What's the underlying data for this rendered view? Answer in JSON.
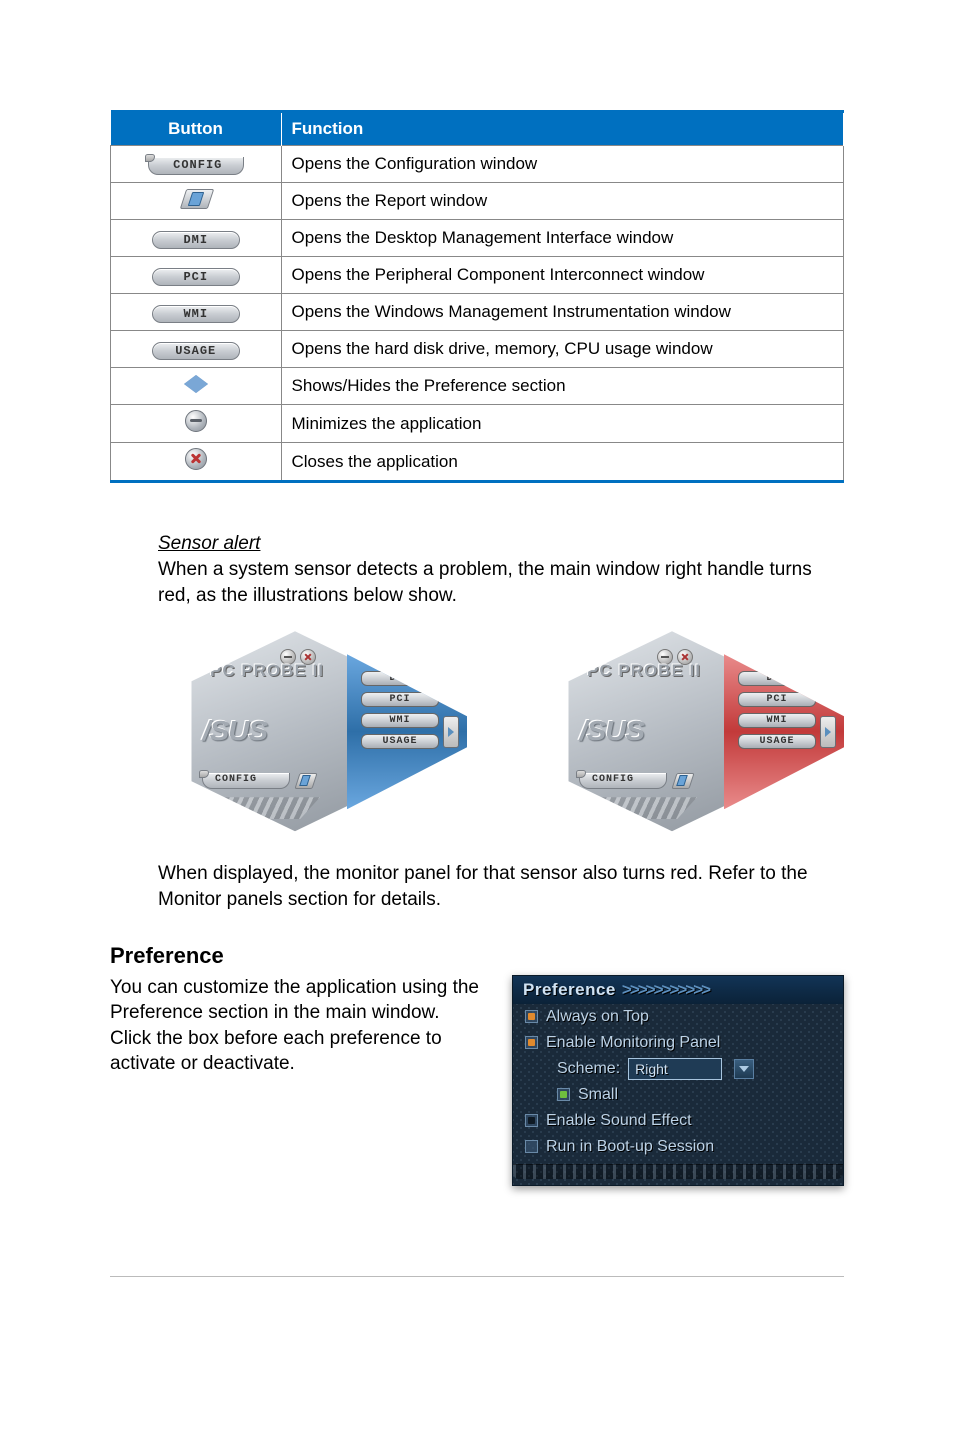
{
  "table": {
    "headers": {
      "button": "Button",
      "function": "Function"
    },
    "rows": [
      {
        "btn_label": "CONFIG",
        "func": "Opens the Configuration window"
      },
      {
        "btn_label": "report-icon",
        "func": "Opens the Report window"
      },
      {
        "btn_label": "DMI",
        "func": "Opens the Desktop Management Interface window"
      },
      {
        "btn_label": "PCI",
        "func": "Opens the Peripheral Component Interconnect window"
      },
      {
        "btn_label": "WMI",
        "func": "Opens the Windows Management Instrumentation window"
      },
      {
        "btn_label": "USAGE",
        "func": "Opens the hard disk drive, memory, CPU usage window"
      },
      {
        "btn_label": "left-right-arrows-icon",
        "func": "Shows/Hides the Preference section"
      },
      {
        "btn_label": "minimize-icon",
        "func": "Minimizes the application"
      },
      {
        "btn_label": "close-icon",
        "func": "Closes the application"
      }
    ]
  },
  "sensor": {
    "heading": "Sensor alert",
    "para1": "When a system sensor detects a problem, the main window right handle turns red, as the illustrations below show.",
    "para2": "When displayed, the monitor panel for that sensor also turns red. Refer to the Monitor panels section for details."
  },
  "pcprobe": {
    "title": "PC PROBE II",
    "logo": "/SUS",
    "config": "CONFIG",
    "slots": [
      "DMI",
      "PCI",
      "WMI",
      "USAGE"
    ]
  },
  "preference": {
    "heading": "Preference",
    "para": "You can customize the application using the Preference section in the main window. Click the box before each preference to activate or deactivate.",
    "panel": {
      "title": "Preference",
      "chevrons": ">>>>>>>>>>>",
      "items": {
        "always_on_top": "Always on Top",
        "enable_monitoring": "Enable Monitoring Panel",
        "scheme_label": "Scheme:",
        "scheme_value": "Right",
        "small": "Small",
        "enable_sound": "Enable Sound Effect",
        "run_boot": "Run in Boot-up Session"
      }
    }
  }
}
